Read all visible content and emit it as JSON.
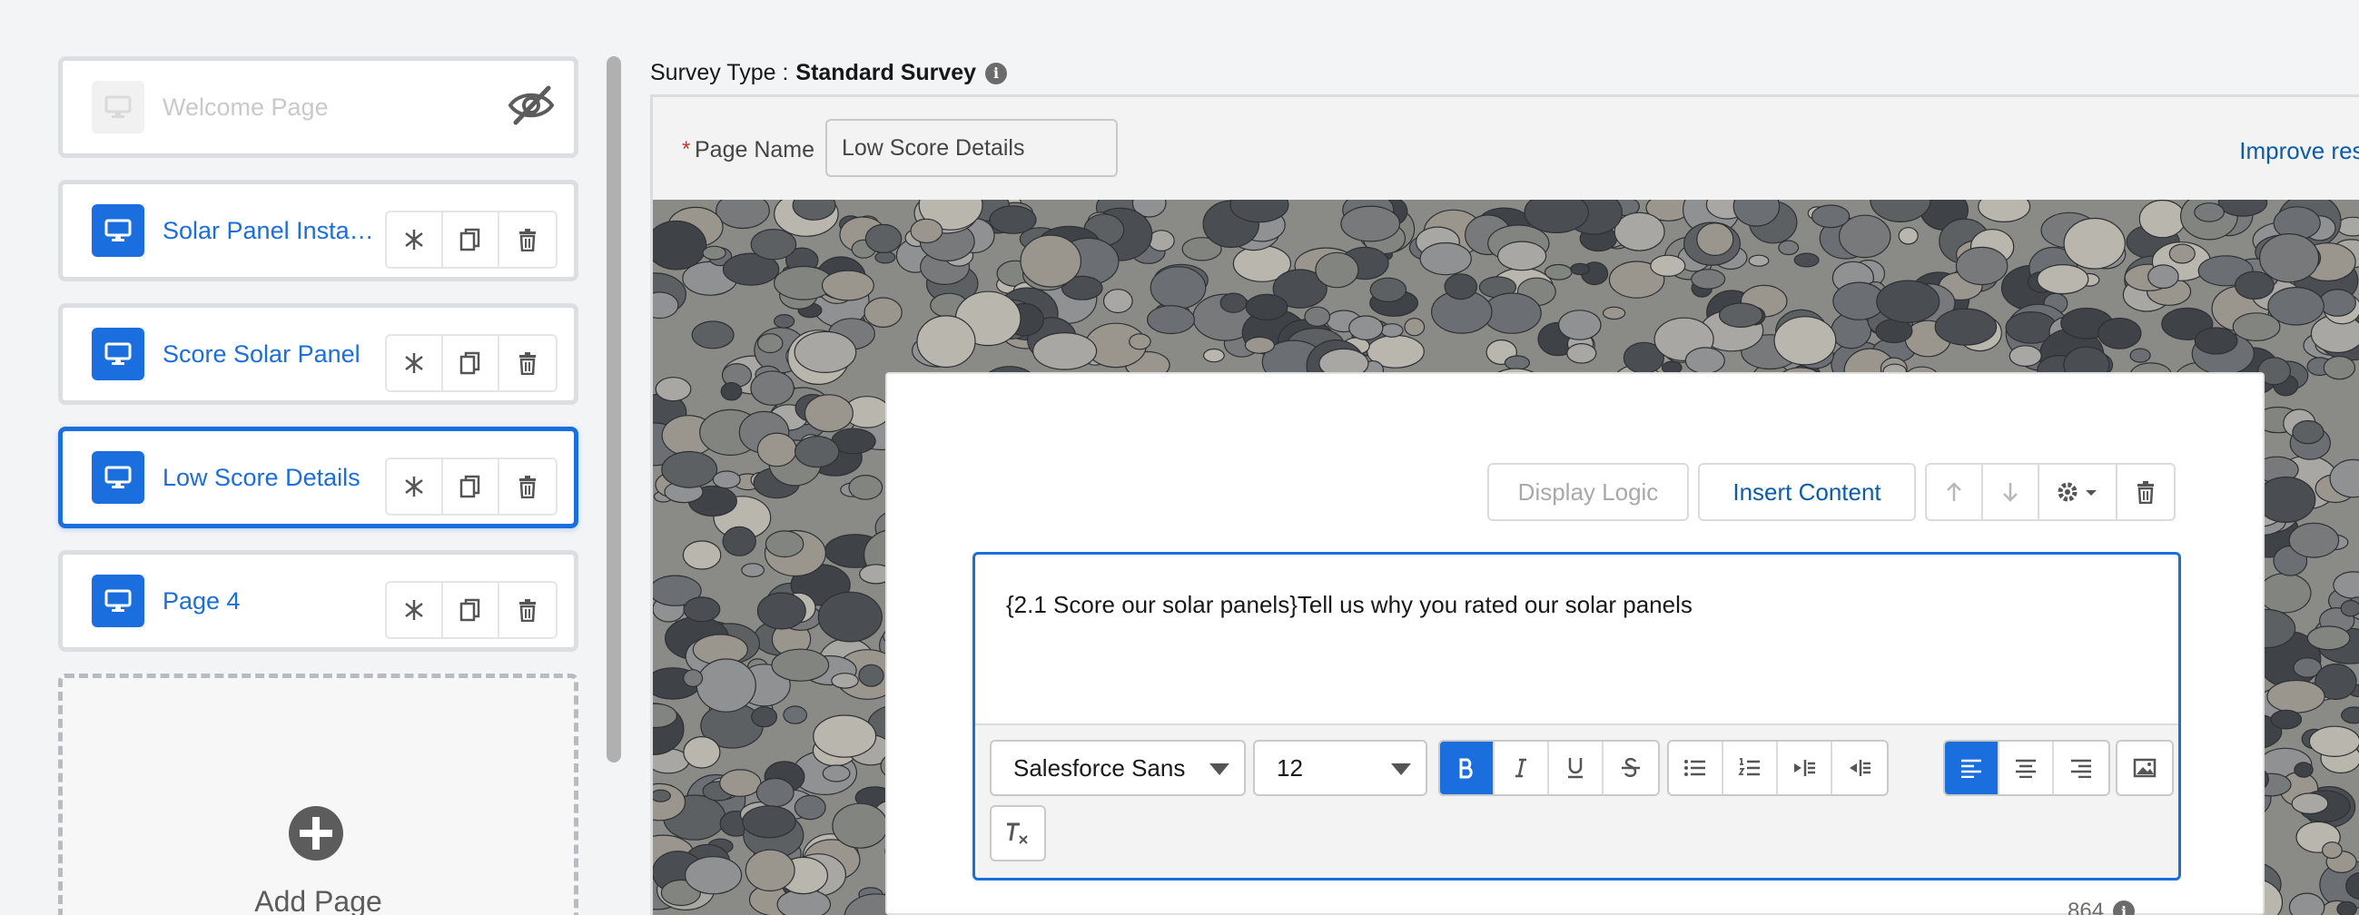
{
  "sidebar": {
    "pages": [
      {
        "label": "Welcome Page",
        "state": "hidden"
      },
      {
        "label": "Solar Panel Install...",
        "state": "normal"
      },
      {
        "label": "Score Solar Panel",
        "state": "normal"
      },
      {
        "label": "Low Score Details",
        "state": "active"
      },
      {
        "label": "Page 4",
        "state": "normal"
      }
    ],
    "add_page_label": "Add Page"
  },
  "header": {
    "survey_type_label": "Survey Type :",
    "survey_type_value": "Standard Survey",
    "info_glyph": "i"
  },
  "page_name": {
    "required_mark": "*",
    "label": "Page Name",
    "value": "Low Score Details",
    "improve_link": "Improve resp"
  },
  "question_toolbar": {
    "display_logic": "Display Logic",
    "insert_content": "Insert Content"
  },
  "editor": {
    "text": "{2.1 Score our solar panels}Tell us why you rated our solar panels",
    "font_family": "Salesforce Sans",
    "font_size": "12"
  },
  "char_count": "864",
  "colors": {
    "accent": "#1b6ede",
    "link": "#0b5cab",
    "required": "#c23934"
  }
}
